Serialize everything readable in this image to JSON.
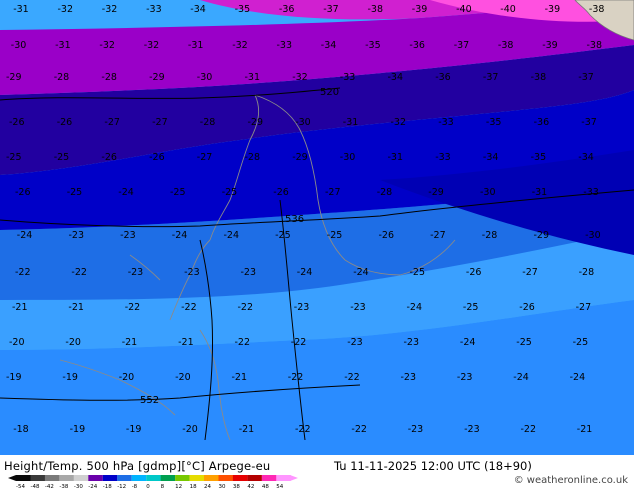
{
  "header": {
    "title": "Height/Temp. 500 hPa [gdmp][°C] Arpege-eu",
    "valid_time": "Tu 11-11-2025 12:00 UTC (18+90)",
    "credit": "weatheronline.co.uk",
    "credit_symbol": "©"
  },
  "legend": {
    "labels": [
      "-54",
      "-48",
      "-42",
      "-38",
      "-30",
      "-24",
      "-18",
      "-12",
      "-8",
      "0",
      "8",
      "12",
      "18",
      "24",
      "30",
      "38",
      "42",
      "48",
      "54"
    ],
    "colors": [
      "#0a0a0a",
      "#3a3a3a",
      "#7a7a7a",
      "#a8a8a8",
      "#d0d0d0",
      "#6a00aa",
      "#0000c8",
      "#1e6ee6",
      "#00b4ff",
      "#00c8c8",
      "#00a050",
      "#78c800",
      "#e6dc00",
      "#ffa000",
      "#ff5000",
      "#e60000",
      "#b40000",
      "#ff28b4",
      "#ff96ff"
    ]
  },
  "map": {
    "land_color": "#d9d2c3",
    "sea_color": "#cfcfcf",
    "contour_labels": [
      "520",
      "536",
      "552"
    ],
    "temperature_labels": [
      "-31",
      "-32",
      "-32",
      "-33",
      "-34",
      "-35",
      "-36",
      "-37",
      "-38",
      "-39",
      "-40",
      "-40",
      "-39",
      "-38",
      "-30",
      "-31",
      "-32",
      "-32",
      "-31",
      "-32",
      "-33",
      "-34",
      "-35",
      "-36",
      "-37",
      "-38",
      "-39",
      "-38",
      "-29",
      "-28",
      "-28",
      "-29",
      "-30",
      "-31",
      "-32",
      "-33",
      "-34",
      "-36",
      "-37",
      "-38",
      "-37",
      "-26",
      "-26",
      "-27",
      "-27",
      "-28",
      "-29",
      "-30",
      "-31",
      "-32",
      "-33",
      "-35",
      "-36",
      "-37",
      "-25",
      "-25",
      "-26",
      "-26",
      "-27",
      "-28",
      "-29",
      "-30",
      "-31",
      "-33",
      "-34",
      "-35",
      "-34",
      "-26",
      "-25",
      "-24",
      "-25",
      "-25",
      "-26",
      "-27",
      "-28",
      "-29",
      "-30",
      "-31",
      "-33",
      "-24",
      "-23",
      "-23",
      "-24",
      "-24",
      "-25",
      "-25",
      "-26",
      "-27",
      "-28",
      "-29",
      "-30",
      "-22",
      "-22",
      "-23",
      "-23",
      "-23",
      "-24",
      "-24",
      "-25",
      "-26",
      "-27",
      "-28",
      "-21",
      "-21",
      "-22",
      "-22",
      "-22",
      "-23",
      "-23",
      "-24",
      "-25",
      "-26",
      "-27",
      "-20",
      "-20",
      "-21",
      "-21",
      "-22",
      "-22",
      "-23",
      "-23",
      "-24",
      "-25",
      "-25",
      "-19",
      "-19",
      "-20",
      "-20",
      "-21",
      "-22",
      "-22",
      "-23",
      "-23",
      "-24",
      "-24",
      "-18",
      "-19",
      "-19",
      "-20",
      "-21",
      "-22",
      "-22",
      "-23",
      "-23",
      "-22",
      "-21"
    ]
  }
}
